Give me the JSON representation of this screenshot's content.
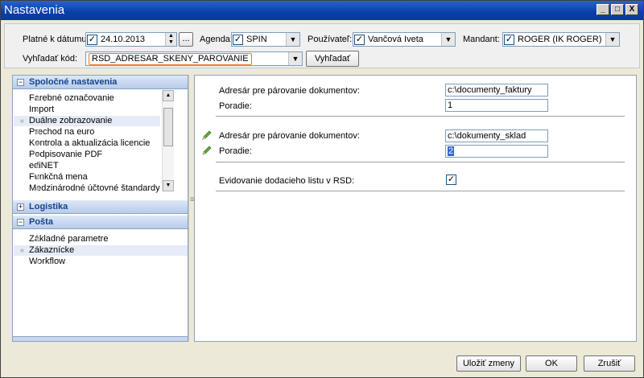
{
  "window": {
    "title": "Nastavenia",
    "controls": {
      "minimize": "_",
      "maximize": "□",
      "close": "X"
    }
  },
  "toolbar": {
    "date_label": "Platné k dátumu:",
    "date_value": "24.10.2013",
    "date_button": "...",
    "agenda_label": "Agenda:",
    "agenda_value": "SPIN",
    "user_label": "Používateľ:",
    "user_value": "Vančová Iveta",
    "mandant_label": "Mandant:",
    "mandant_value": "ROGER (IK ROGER)",
    "search_label": "Vyhľadať kód:",
    "search_value": "RSD_ADRESAR_SKENY_PAROVANIE",
    "search_button": "Vyhľadať"
  },
  "sidebar": {
    "sections": [
      {
        "title": "Spoločné nastavenia",
        "toggle": "−",
        "items": [
          "Farebné označovanie",
          "Import",
          "Duálne zobrazovanie",
          "Prechod na euro",
          "Kontrola a aktualizácia licencie",
          "Podpisovanie PDF",
          "ediNET",
          "Funkčná mena",
          "Medzinárodné účtovné štandardy"
        ]
      },
      {
        "title": "Logistika",
        "toggle": "+"
      },
      {
        "title": "Pošta",
        "toggle": "−",
        "items": [
          "Základné parametre",
          "Zákaznícke",
          "Workflow"
        ]
      }
    ]
  },
  "settings": {
    "group1": {
      "dir_label": "Adresár pre párovanie dokumentov:",
      "dir_value": "c:\\documenty_faktury",
      "order_label": "Poradie:",
      "order_value": "1"
    },
    "group2": {
      "dir_label": "Adresár pre párovanie dokumentov:",
      "dir_value": "c:\\dokumenty_sklad",
      "order_label": "Poradie:",
      "order_value": "2"
    },
    "group3": {
      "delivery_label": "Evidovanie dodacieho listu v RSD:",
      "delivery_checked": "✓"
    }
  },
  "footer": {
    "save_label": "Uložiť zmeny",
    "ok_label": "OK",
    "cancel_label": "Zrušiť"
  },
  "colors": {
    "title_bar": "#0a3ea8",
    "section_header_text": "#15428b",
    "search_highlight": "#e87830",
    "edit_icon": "#6aa84f"
  }
}
